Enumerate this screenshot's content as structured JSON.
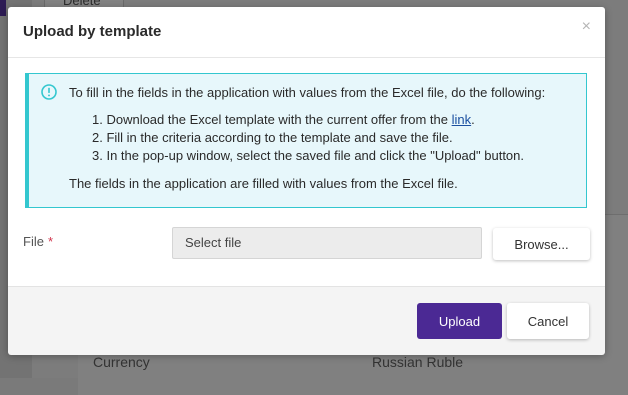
{
  "background": {
    "delete_label": "Delete",
    "currency_label": "Currency",
    "currency_value": "Russian Ruble"
  },
  "modal": {
    "title": "Upload by template",
    "close_label": "×",
    "alert": {
      "icon": "info-circle-icon",
      "lead": "To fill in the fields in the application with values from the Excel file, do the following:",
      "steps": [
        {
          "prefix": "1. Download the Excel template with the current offer from the ",
          "link": "link",
          "suffix": "."
        },
        {
          "text": "2. Fill in the criteria according to the template and save the file."
        },
        {
          "text": "3. In the pop-up window, select the saved file and click the \"Upload\" button."
        }
      ],
      "footer": "The fields in the application are filled with values from the Excel file."
    },
    "file_field": {
      "label": "File",
      "required_mark": "*",
      "value": "Select file",
      "browse_label": "Browse..."
    },
    "buttons": {
      "upload_label": "Upload",
      "cancel_label": "Cancel"
    },
    "colors": {
      "primary": "#4b2994",
      "alert_border": "#33c7cf",
      "alert_bg": "#e7f7fb",
      "required": "#d0334b"
    }
  }
}
